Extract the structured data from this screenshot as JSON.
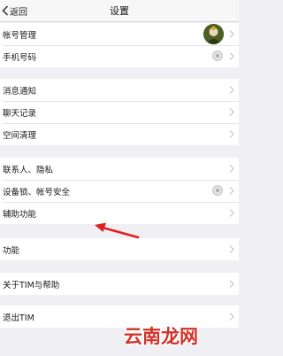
{
  "nav": {
    "back_label": "返回",
    "title": "设置"
  },
  "groups": [
    {
      "items": [
        {
          "label": "帐号管理",
          "accessory": "avatar"
        },
        {
          "label": "手机号码",
          "accessory": "status-disc"
        }
      ]
    },
    {
      "items": [
        {
          "label": "消息通知"
        },
        {
          "label": "聊天记录"
        },
        {
          "label": "空间清理"
        }
      ]
    },
    {
      "items": [
        {
          "label": "联系人、隐私"
        },
        {
          "label": "设备锁、帐号安全",
          "accessory": "status-disc"
        },
        {
          "label": "辅助功能"
        }
      ]
    },
    {
      "items": [
        {
          "label": "功能"
        }
      ]
    },
    {
      "items": [
        {
          "label": "关于TIM与帮助"
        }
      ]
    },
    {
      "items": [
        {
          "label": "退出TIM"
        }
      ]
    }
  ],
  "annotation": {
    "arrow_color": "#e02020",
    "points_to": "辅助功能"
  },
  "watermark": {
    "text": "云南龙网",
    "color": "#d0322a"
  }
}
